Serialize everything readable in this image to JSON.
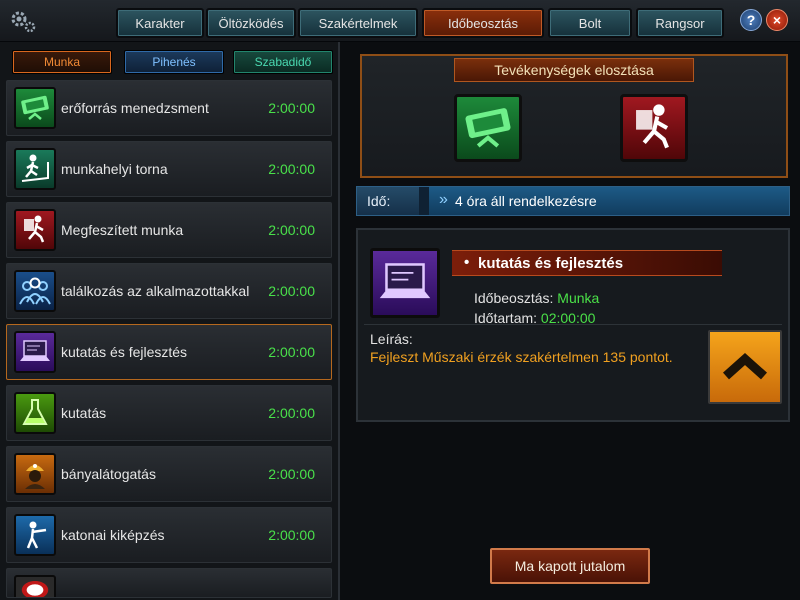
{
  "tabs": [
    "Karakter",
    "Öltözködés",
    "Szakértelmek",
    "Időbeosztás",
    "Bolt",
    "Rangsor"
  ],
  "active_tab": "Időbeosztás",
  "subtabs": {
    "munka": "Munka",
    "pihenes": "Pihenés",
    "szabadido": "Szabadidő"
  },
  "activities": [
    {
      "name": "erőforrás menedzsment",
      "time": "2:00:00",
      "icon": "money-icon"
    },
    {
      "name": "munkahelyi torna",
      "time": "2:00:00",
      "icon": "treadmill-icon"
    },
    {
      "name": "Megfeszített munka",
      "time": "2:00:00",
      "icon": "running-worker-icon"
    },
    {
      "name": "találkozás az alkalmazottakkal",
      "time": "2:00:00",
      "icon": "meeting-icon"
    },
    {
      "name": "kutatás és fejlesztés",
      "time": "2:00:00",
      "icon": "laptop-icon"
    },
    {
      "name": "kutatás",
      "time": "2:00:00",
      "icon": "flask-icon"
    },
    {
      "name": "bányalátogatás",
      "time": "2:00:00",
      "icon": "miner-icon"
    },
    {
      "name": "katonai kiképzés",
      "time": "2:00:00",
      "icon": "soldier-icon"
    }
  ],
  "distribution": {
    "title": "Tevékenységek elosztása"
  },
  "ido": {
    "label": "Idő:",
    "value": "4 óra áll rendelkezésre"
  },
  "detail": {
    "title": "kutatás és fejlesztés",
    "schedule_label": "Időbeosztás: ",
    "schedule_value": "Munka",
    "duration_label": "Időtartam: ",
    "duration_value": "02:00:00",
    "desc_label": "Leírás:",
    "desc_text": "Fejleszt Műszaki érzék szakértelmen 135 pontot."
  },
  "reward_button": "Ma kapott jutalom",
  "colors": {
    "accent_orange": "#f08a35",
    "time_green": "#49e04a",
    "tab_teal": "#2d5560",
    "active_tab": "#8a2f0c"
  }
}
